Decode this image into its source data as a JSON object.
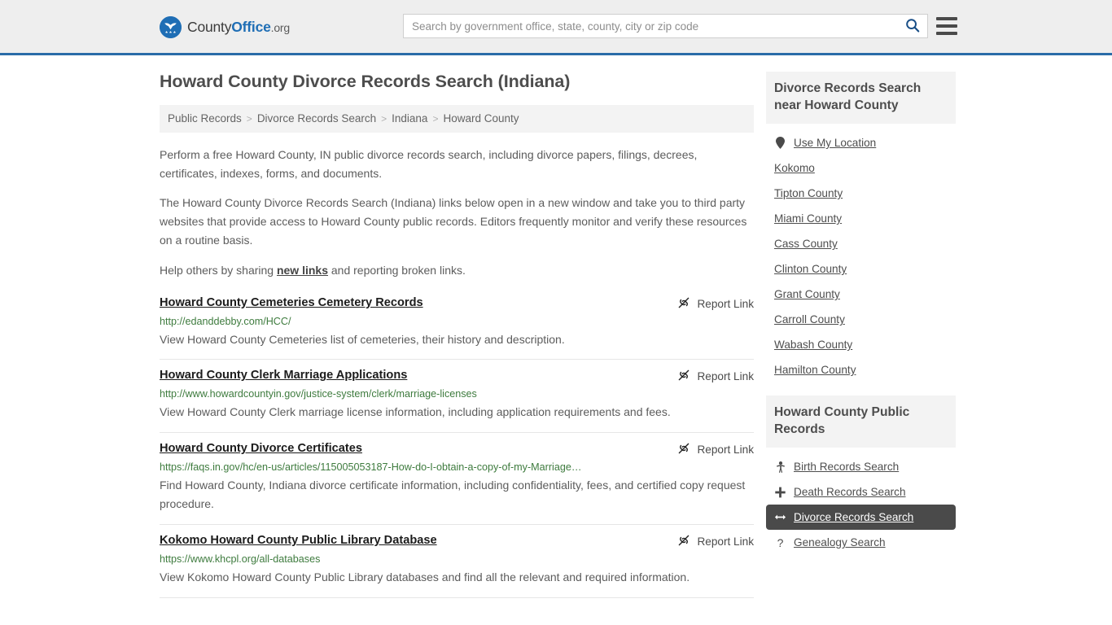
{
  "header": {
    "brand": {
      "county": "County",
      "office": "Office",
      "org": ".org"
    },
    "search": {
      "placeholder": "Search by government office, state, county, city or zip code",
      "value": "",
      "search_icon": "search-icon"
    },
    "menu_icon": "hamburger-menu-icon",
    "accent_color": "#2a6ca8",
    "background_color": "#eeeeee"
  },
  "main": {
    "title": "Howard County Divorce Records Search (Indiana)",
    "breadcrumb": [
      {
        "label": "Public Records"
      },
      {
        "label": "Divorce Records Search"
      },
      {
        "label": "Indiana"
      },
      {
        "label": "Howard County"
      }
    ],
    "breadcrumb_separator": ">",
    "intro": {
      "p1": "Perform a free Howard County, IN public divorce records search, including divorce papers, filings, decrees, certificates, indexes, forms, and documents.",
      "p2": "The Howard County Divorce Records Search (Indiana) links below open in a new window and take you to third party websites that provide access to Howard County public records. Editors frequently monitor and verify these resources on a routine basis.",
      "p3_before": "Help others by sharing ",
      "p3_link": "new links",
      "p3_after": " and reporting broken links."
    },
    "report_link_label": "Report Link",
    "report_link_icon": "broken-link-icon",
    "results": [
      {
        "title": "Howard County Cemeteries Cemetery Records",
        "url": "http://edanddebby.com/HCC/",
        "description": "View Howard County Cemeteries list of cemeteries, their history and description."
      },
      {
        "title": "Howard County Clerk Marriage Applications",
        "url": "http://www.howardcountyin.gov/justice-system/clerk/marriage-licenses",
        "description": "View Howard County Clerk marriage license information, including application requirements and fees."
      },
      {
        "title": "Howard County Divorce Certificates",
        "url": "https://faqs.in.gov/hc/en-us/articles/115005053187-How-do-I-obtain-a-copy-of-my-Marriage…",
        "description": "Find Howard County, Indiana divorce certificate information, including confidentiality, fees, and certified copy request procedure."
      },
      {
        "title": "Kokomo Howard County Public Library Database",
        "url": "https://www.khcpl.org/all-databases",
        "description": "View Kokomo Howard County Public Library databases and find all the relevant and required information."
      }
    ]
  },
  "sidebar": {
    "nearby": {
      "heading": "Divorce Records Search near Howard County",
      "items": [
        {
          "label": "Use My Location",
          "icon": "map-pin-icon"
        },
        {
          "label": "Kokomo",
          "icon": ""
        },
        {
          "label": "Tipton County",
          "icon": ""
        },
        {
          "label": "Miami County",
          "icon": ""
        },
        {
          "label": "Cass County",
          "icon": ""
        },
        {
          "label": "Clinton County",
          "icon": ""
        },
        {
          "label": "Grant County",
          "icon": ""
        },
        {
          "label": "Carroll County",
          "icon": ""
        },
        {
          "label": "Wabash County",
          "icon": ""
        },
        {
          "label": "Hamilton County",
          "icon": ""
        }
      ]
    },
    "public_records": {
      "heading": "Howard County Public Records",
      "items": [
        {
          "label": "Birth Records Search",
          "icon": "baby-icon",
          "active": false
        },
        {
          "label": "Death Records Search",
          "icon": "cross-icon",
          "active": false
        },
        {
          "label": "Divorce Records Search",
          "icon": "split-arrows-icon",
          "active": true
        },
        {
          "label": "Genealogy Search",
          "icon": "question-mark-icon",
          "active": false
        }
      ],
      "active_background": "#4a4a4a"
    }
  }
}
